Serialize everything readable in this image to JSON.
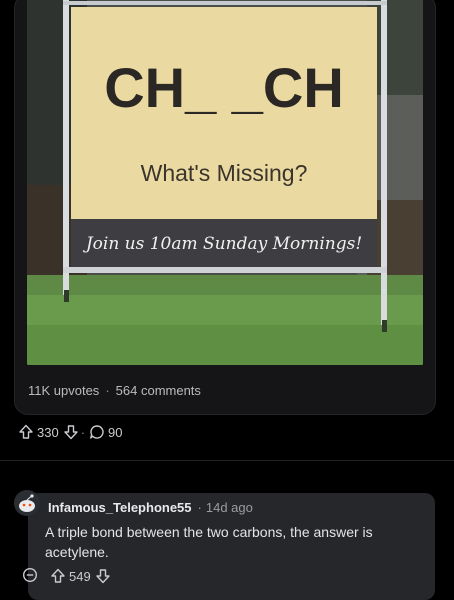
{
  "post": {
    "sign": {
      "headline": "CH_ _CH",
      "question": "What's Missing?",
      "banner": "Join us 10am Sunday Mornings!"
    },
    "upvotes": "11K upvotes",
    "comments_count": "564 comments",
    "stat_separator": "·"
  },
  "actions": {
    "upvote_icon": "arrow-up-icon",
    "score": "330",
    "downvote_icon": "arrow-down-icon",
    "separator": "·",
    "comment_icon": "speech-bubble-icon",
    "comment_count": "90"
  },
  "comment": {
    "author": "Infamous_Telephone55",
    "separator": "·",
    "time": "14d ago",
    "body": "A triple bond between the two carbons, the answer is acetylene.",
    "score": "549",
    "collapse_icon": "minus-circle-icon"
  },
  "colors": {
    "background": "#000000",
    "card": "#151517",
    "comment_card": "#25272b",
    "sign_yellow": "#ead9a0",
    "banner_gray": "#3e3e42"
  }
}
